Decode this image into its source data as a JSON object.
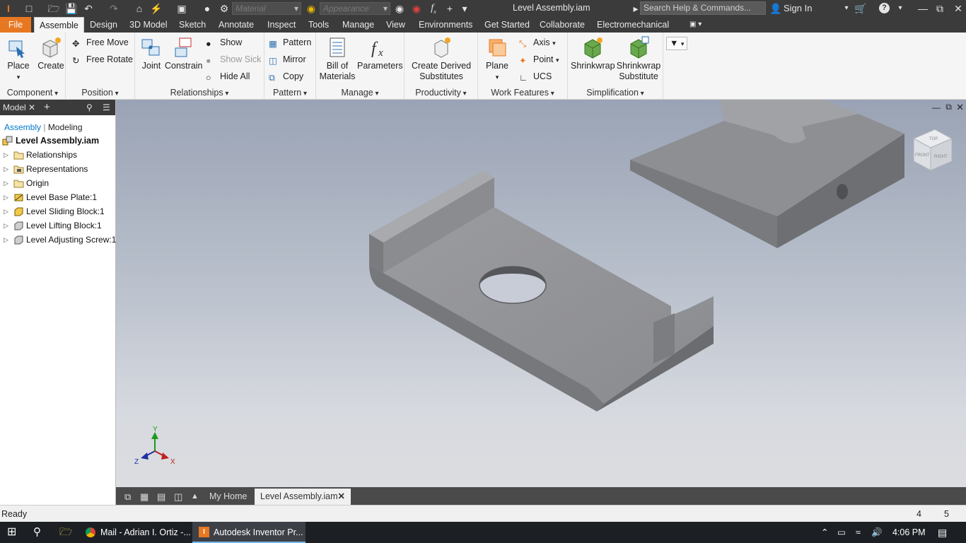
{
  "window": {
    "title": "Level Assembly.iam"
  },
  "qat": {
    "material_placeholder": "Material",
    "appearance_placeholder": "Appearance",
    "search_placeholder": "Search Help & Commands...",
    "sign_in": "Sign In"
  },
  "tabs": [
    "File",
    "Assemble",
    "Design",
    "3D Model",
    "Sketch",
    "Annotate",
    "Inspect",
    "Tools",
    "Manage",
    "View",
    "Environments",
    "Get Started",
    "Collaborate",
    "Electromechanical"
  ],
  "active_tab": "Assemble",
  "ribbon": {
    "component": {
      "title": "Component",
      "place": "Place",
      "create": "Create"
    },
    "position": {
      "title": "Position",
      "free_move": "Free Move",
      "free_rotate": "Free Rotate"
    },
    "relationships": {
      "title": "Relationships",
      "joint": "Joint",
      "constrain": "Constrain",
      "show": "Show",
      "show_sick": "Show Sick",
      "hide_all": "Hide All"
    },
    "pattern": {
      "title": "Pattern",
      "pattern": "Pattern",
      "mirror": "Mirror",
      "copy": "Copy"
    },
    "manage": {
      "title": "Manage",
      "bom1": "Bill of",
      "bom2": "Materials",
      "parameters": "Parameters"
    },
    "productivity": {
      "title": "Productivity",
      "cds1": "Create Derived",
      "cds2": "Substitutes"
    },
    "work_features": {
      "title": "Work Features",
      "plane": "Plane",
      "axis": "Axis",
      "point": "Point",
      "ucs": "UCS"
    },
    "simplification": {
      "title": "Simplification",
      "shrinkwrap": "Shrinkwrap",
      "sws1": "Shrinkwrap",
      "sws2": "Substitute"
    }
  },
  "browser": {
    "header": "Model",
    "tab_assembly": "Assembly",
    "tab_modeling": "Modeling",
    "root": "Level Assembly.iam",
    "nodes": [
      "Relationships",
      "Representations",
      "Origin",
      "Level Base Plate:1",
      "Level Sliding Block:1",
      "Level Lifting Block:1",
      "Level Adjusting Screw:1"
    ]
  },
  "doc_tabs": {
    "home": "My Home",
    "active": "Level Assembly.iam"
  },
  "status": {
    "text": "Ready",
    "n1": "4",
    "n2": "5"
  },
  "taskbar": {
    "chrome": "Mail - Adrian I. Ortiz -...",
    "inventor": "Autodesk Inventor Pr...",
    "time": "4:06 PM"
  },
  "viewcube": {
    "top": "TOP",
    "front": "FRONT",
    "right": "RIGHT"
  },
  "axes": {
    "x": "X",
    "y": "Y",
    "z": "Z"
  },
  "colors": {
    "accent": "#e87722",
    "part_gray": "#8e8f93",
    "link_blue": "#0077cc"
  }
}
